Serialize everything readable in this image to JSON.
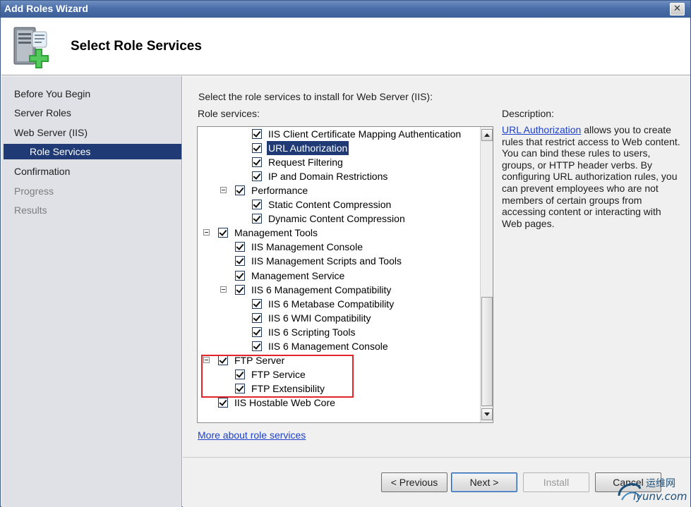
{
  "window": {
    "title": "Add Roles Wizard",
    "close_glyph": "✕"
  },
  "header": {
    "title": "Select Role Services",
    "icon": "server-add-icon"
  },
  "nav": {
    "items": [
      {
        "label": "Before You Begin",
        "state": "normal"
      },
      {
        "label": "Server Roles",
        "state": "normal"
      },
      {
        "label": "Web Server (IIS)",
        "state": "normal"
      },
      {
        "label": "Role Services",
        "state": "selected"
      },
      {
        "label": "Confirmation",
        "state": "normal"
      },
      {
        "label": "Progress",
        "state": "disabled"
      },
      {
        "label": "Results",
        "state": "disabled"
      }
    ]
  },
  "main": {
    "instruction": "Select the role services to install for Web Server (IIS):",
    "list_label": "Role services:",
    "description_label": "Description:",
    "description_link": "URL Authorization",
    "description_text": " allows you to create rules that restrict access to Web content. You can bind these rules to users, groups, or HTTP header verbs. By configuring URL authorization rules, you can prevent employees who are not members of certain groups from accessing content or interacting with Web pages.",
    "more_link": "More about role services",
    "tree": [
      {
        "label": "IIS Client Certificate Mapping Authentication",
        "level": 3,
        "checked": true,
        "expander": false
      },
      {
        "label": "URL Authorization",
        "level": 3,
        "checked": true,
        "expander": false,
        "selected": true
      },
      {
        "label": "Request Filtering",
        "level": 3,
        "checked": true,
        "expander": false
      },
      {
        "label": "IP and Domain Restrictions",
        "level": 3,
        "checked": true,
        "expander": false
      },
      {
        "label": "Performance",
        "level": 2,
        "checked": true,
        "expander": true
      },
      {
        "label": "Static Content Compression",
        "level": 3,
        "checked": true,
        "expander": false
      },
      {
        "label": "Dynamic Content Compression",
        "level": 3,
        "checked": true,
        "expander": false
      },
      {
        "label": "Management Tools",
        "level": 1,
        "checked": true,
        "expander": true
      },
      {
        "label": "IIS Management Console",
        "level": 2,
        "checked": true,
        "expander": false
      },
      {
        "label": "IIS Management Scripts and Tools",
        "level": 2,
        "checked": true,
        "expander": false
      },
      {
        "label": "Management Service",
        "level": 2,
        "checked": true,
        "expander": false
      },
      {
        "label": "IIS 6 Management Compatibility",
        "level": 2,
        "checked": true,
        "expander": true
      },
      {
        "label": "IIS 6 Metabase Compatibility",
        "level": 3,
        "checked": true,
        "expander": false
      },
      {
        "label": "IIS 6 WMI Compatibility",
        "level": 3,
        "checked": true,
        "expander": false
      },
      {
        "label": "IIS 6 Scripting Tools",
        "level": 3,
        "checked": true,
        "expander": false
      },
      {
        "label": "IIS 6 Management Console",
        "level": 3,
        "checked": true,
        "expander": false
      },
      {
        "label": "FTP Server",
        "level": 1,
        "checked": true,
        "expander": true
      },
      {
        "label": "FTP Service",
        "level": 2,
        "checked": true,
        "expander": false
      },
      {
        "label": "FTP Extensibility",
        "level": 2,
        "checked": true,
        "expander": false
      },
      {
        "label": "IIS Hostable Web Core",
        "level": 1,
        "checked": true,
        "expander": false
      }
    ]
  },
  "footer": {
    "previous": "< Previous",
    "next": "Next >",
    "install": "Install",
    "cancel": "Cancel"
  },
  "watermark": {
    "line1": "运维网",
    "line2": "iyunv.com"
  },
  "colors": {
    "selection": "#1f3a74",
    "highlight_box": "#e0262b",
    "link": "#1d40c8"
  }
}
